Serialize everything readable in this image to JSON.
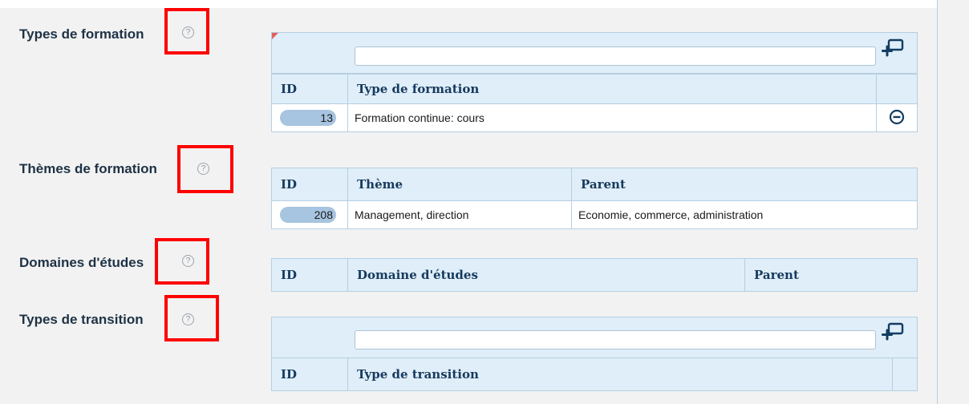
{
  "sections": [
    {
      "label": "Types de formation",
      "filter_value": "",
      "columns": [
        "ID",
        "Type de formation",
        ""
      ],
      "rows": [
        {
          "id": "13",
          "value": "Formation continue: cours"
        }
      ]
    },
    {
      "label": "Thèmes de formation",
      "columns": [
        "ID",
        "Thème",
        "Parent"
      ],
      "rows": [
        {
          "id": "208",
          "theme": "Management, direction",
          "parent": "Economie, commerce, administration"
        }
      ]
    },
    {
      "label": "Domaines d'études",
      "columns": [
        "ID",
        "Domaine d'études",
        "Parent"
      ],
      "rows": []
    },
    {
      "label": "Types de transition",
      "filter_value": "",
      "columns": [
        "ID",
        "Type de transition",
        ""
      ],
      "rows": []
    }
  ],
  "help_symbol": "?",
  "icons": {
    "help": "help-circle-icon",
    "add": "add-item-icon",
    "remove": "remove-circle-icon"
  },
  "colors": {
    "header_bg": "#dfeef8",
    "header_text": "#173a5e",
    "label_text": "#1e3245",
    "pill": "#a7c4e0",
    "highlight": "#ff0000"
  }
}
